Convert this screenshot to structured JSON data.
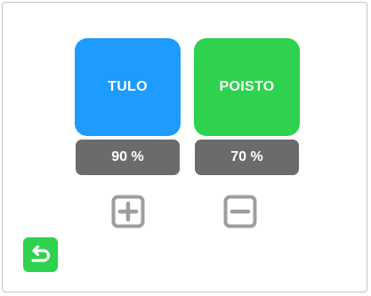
{
  "colors": {
    "supply": "#1e9bff",
    "exhaust": "#2ed24e",
    "value_badge": "#6b6b6b",
    "stepper": "#9e9e9e",
    "back": "#2ed24e"
  },
  "supply": {
    "label": "TULO",
    "value": "90 %"
  },
  "exhaust": {
    "label": "POISTO",
    "value": "70 %"
  },
  "icons": {
    "increase": "plus-square-icon",
    "decrease": "minus-square-icon",
    "back": "return-arrow-icon"
  }
}
